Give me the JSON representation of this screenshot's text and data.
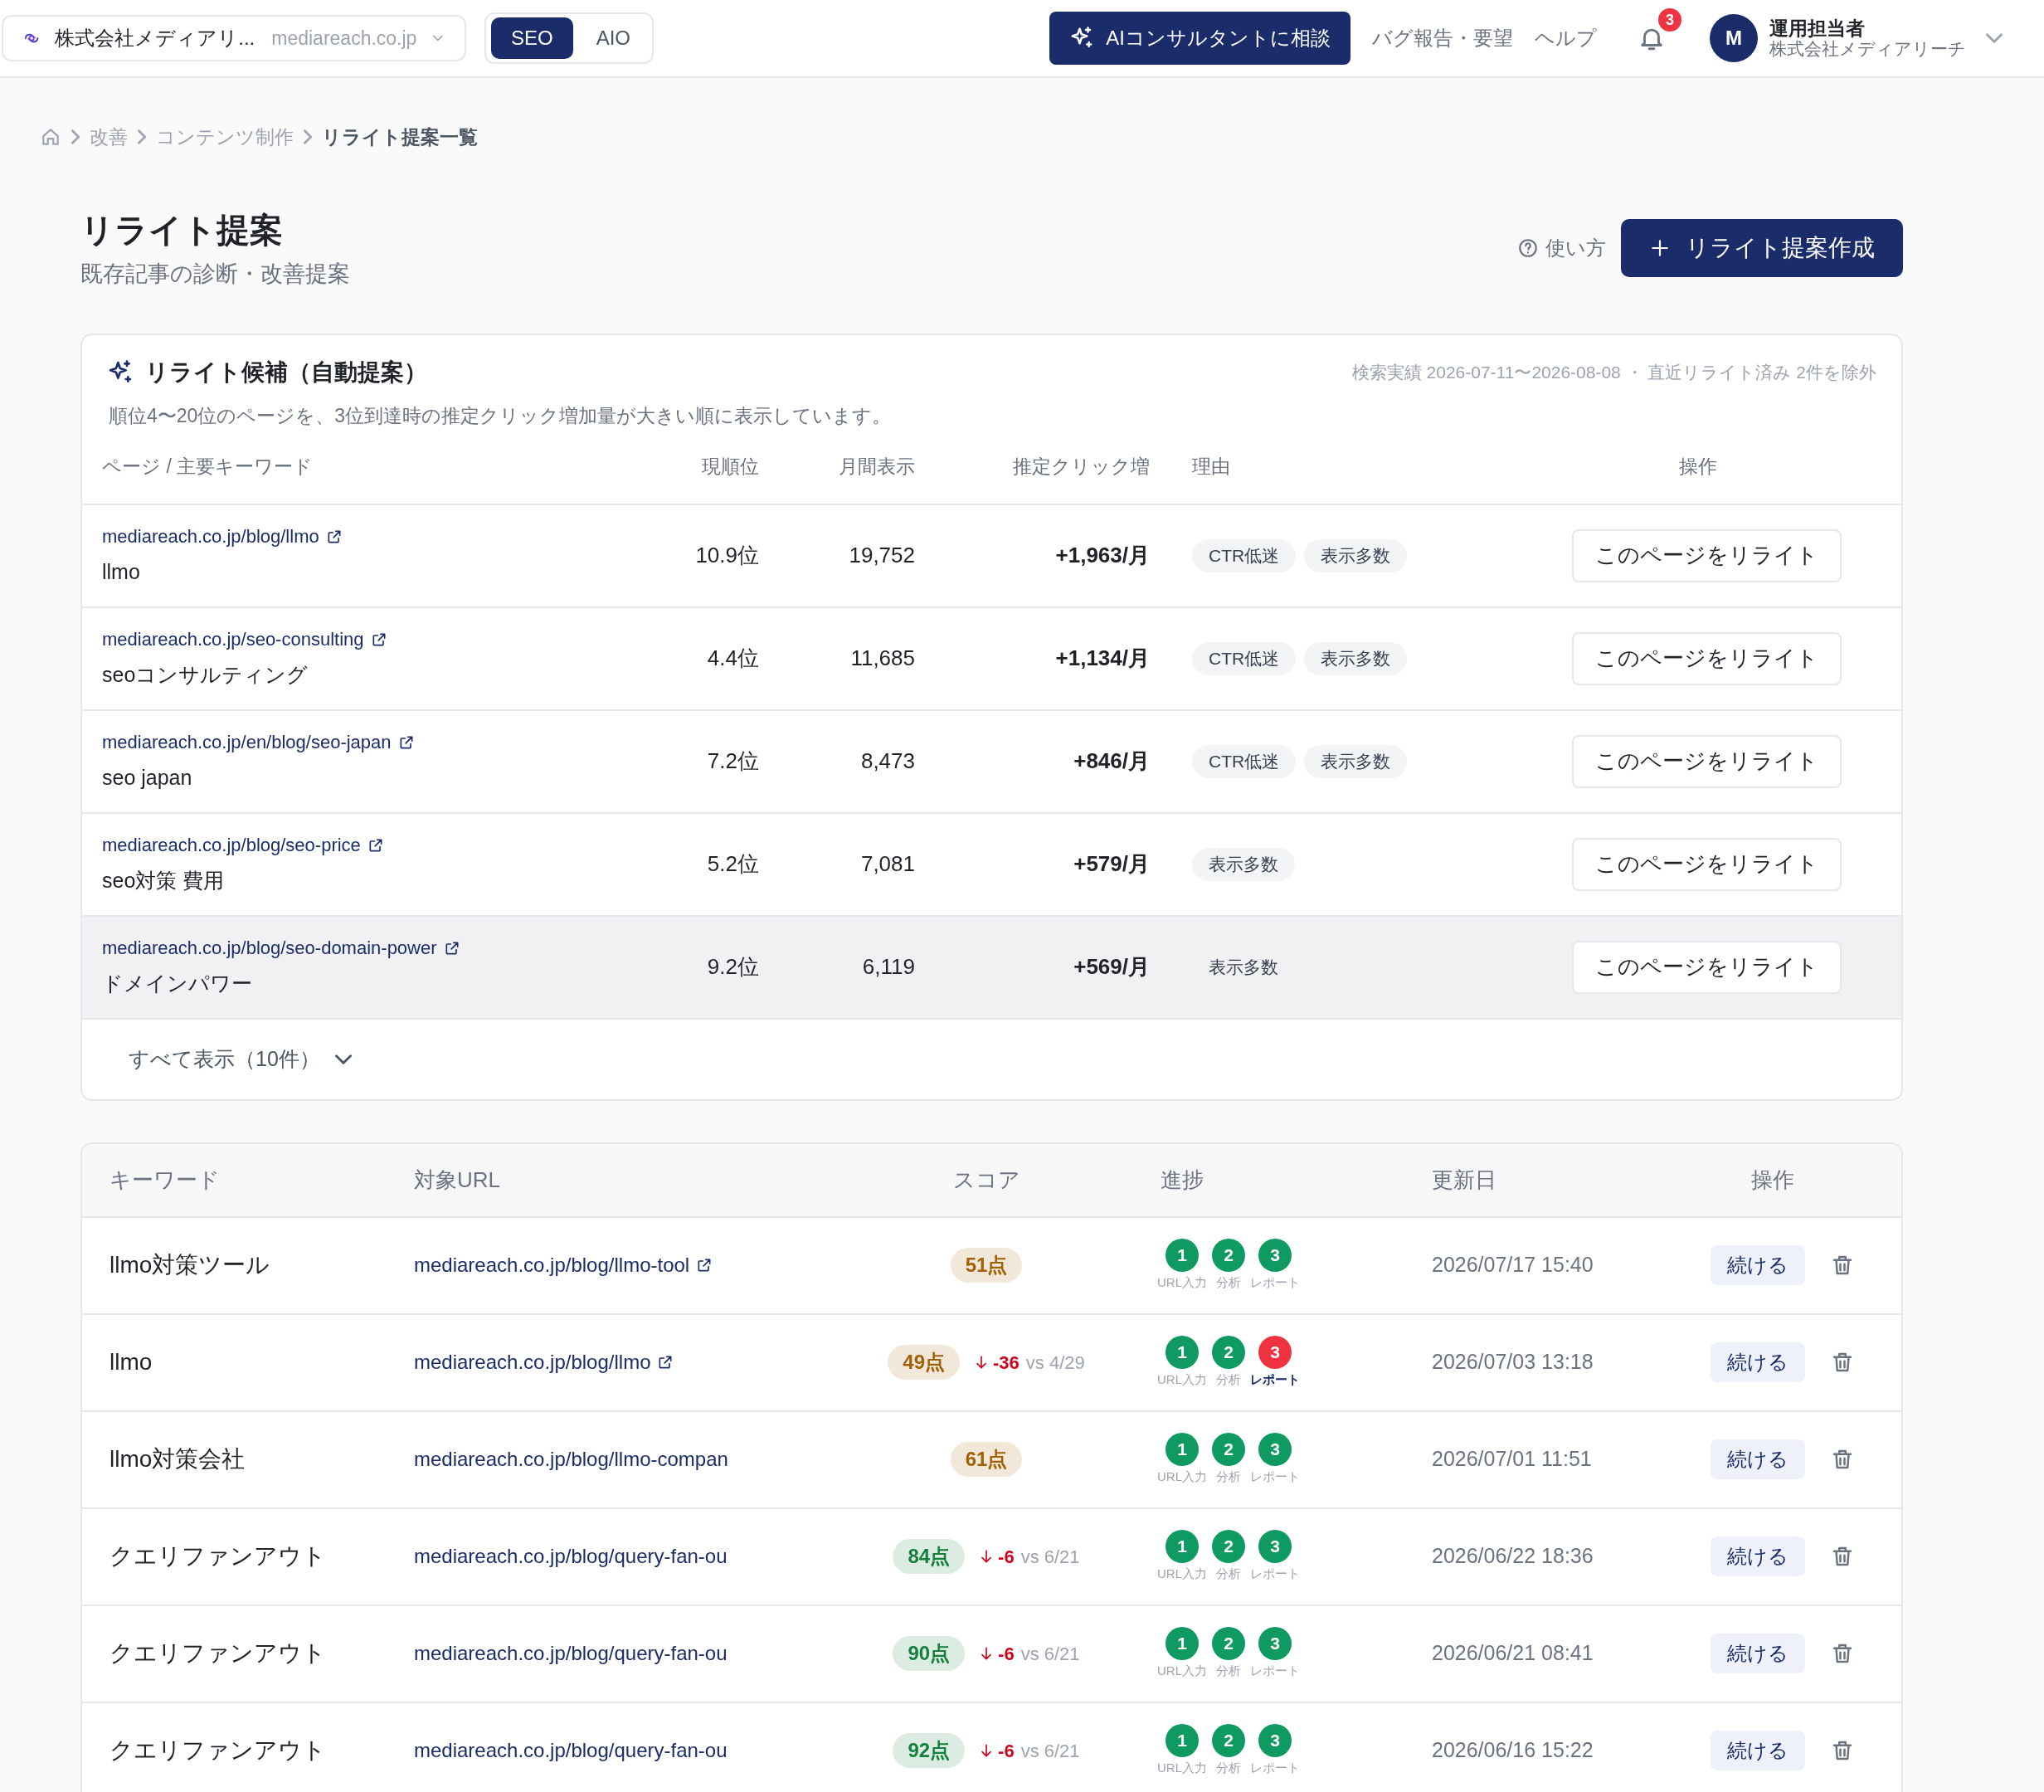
{
  "top_bar": {
    "org_selector": {
      "name": "株式会社メディアリ...",
      "domain": "mediareach.co.jp"
    },
    "mode_tabs": [
      {
        "label": "SEO",
        "selected": true
      },
      {
        "label": "AIO",
        "selected": false
      }
    ],
    "ai_button": "AIコンサルタントに相談",
    "links": [
      "バグ報告・要望",
      "ヘルプ"
    ],
    "notifications": "3",
    "user": {
      "initial": "M",
      "name": "運用担当者",
      "org": "株式会社メディアリーチ"
    }
  },
  "breadcrumb": [
    {
      "label": "改善",
      "current": false
    },
    {
      "label": "コンテンツ制作",
      "current": false
    },
    {
      "label": "リライト提案一覧",
      "current": true
    }
  ],
  "page": {
    "title": "リライト提案",
    "subtitle": "既存記事の診断・改善提案",
    "help_link": "使い方",
    "create_button": "リライト提案作成"
  },
  "candidates": {
    "title": "リライト候補（自動提案）",
    "meta": "検索実績 2026-07-11〜2026-08-08 ・ 直近リライト済み 2件を除外",
    "description": "順位4〜20位のページを、3位到達時の推定クリック増加量が大きい順に表示しています。",
    "columns": [
      "ページ / 主要キーワード",
      "現順位",
      "月間表示",
      "推定クリック増",
      "理由",
      "操作"
    ],
    "rows": [
      {
        "url": "mediareach.co.jp/blog/llmo",
        "keyword": "llmo",
        "rank": "10.9位",
        "impressions": "19,752",
        "click_gain": "+1,963/月",
        "reasons": [
          "CTR低迷",
          "表示多数"
        ],
        "action": "このページをリライト",
        "hovered": false
      },
      {
        "url": "mediareach.co.jp/seo-consulting",
        "keyword": "seoコンサルティング",
        "rank": "4.4位",
        "impressions": "11,685",
        "click_gain": "+1,134/月",
        "reasons": [
          "CTR低迷",
          "表示多数"
        ],
        "action": "このページをリライト",
        "hovered": false
      },
      {
        "url": "mediareach.co.jp/en/blog/seo-japan",
        "keyword": "seo japan",
        "rank": "7.2位",
        "impressions": "8,473",
        "click_gain": "+846/月",
        "reasons": [
          "CTR低迷",
          "表示多数"
        ],
        "action": "このページをリライト",
        "hovered": false
      },
      {
        "url": "mediareach.co.jp/blog/seo-price",
        "keyword": "seo対策 費用",
        "rank": "5.2位",
        "impressions": "7,081",
        "click_gain": "+579/月",
        "reasons": [
          "表示多数"
        ],
        "action": "このページをリライト",
        "hovered": false
      },
      {
        "url": "mediareach.co.jp/blog/seo-domain-power",
        "keyword": "ドメインパワー",
        "rank": "9.2位",
        "impressions": "6,119",
        "click_gain": "+569/月",
        "reasons": [
          "表示多数"
        ],
        "action": "このページをリライト",
        "hovered": true
      }
    ],
    "show_all": "すべて表示（10件）"
  },
  "history": {
    "columns": [
      "キーワード",
      "対象URL",
      "スコア",
      "進捗",
      "更新日",
      "操作"
    ],
    "rows": [
      {
        "keyword": "llmo対策ツール",
        "url": "mediareach.co.jp/blog/llmo-tool",
        "external": true,
        "score": "51点",
        "color": "#a16207",
        "delta": null,
        "steps": [
          {
            "number": "1",
            "label": "URL入力",
            "failed": false
          },
          {
            "number": "2",
            "label": "分析",
            "failed": false
          },
          {
            "number": "3",
            "label": "レポート",
            "failed": false
          }
        ],
        "updated": "2026/07/17 15:40",
        "action": "続ける"
      },
      {
        "keyword": "llmo",
        "url": "mediareach.co.jp/blog/llmo",
        "external": true,
        "score": "49点",
        "color": "#a16207",
        "delta": {
          "value": "-36",
          "vs": "vs 4/29"
        },
        "steps": [
          {
            "number": "1",
            "label": "URL入力",
            "failed": false
          },
          {
            "number": "2",
            "label": "分析",
            "failed": false
          },
          {
            "number": "3",
            "label": "レポート",
            "failed": true
          }
        ],
        "updated": "2026/07/03 13:18",
        "action": "続ける"
      },
      {
        "keyword": "llmo対策会社",
        "url": "mediareach.co.jp/blog/llmo-compan",
        "external": false,
        "score": "61点",
        "color": "#a16207",
        "delta": null,
        "steps": [
          {
            "number": "1",
            "label": "URL入力",
            "failed": false
          },
          {
            "number": "2",
            "label": "分析",
            "failed": false
          },
          {
            "number": "3",
            "label": "レポート",
            "failed": false
          }
        ],
        "updated": "2026/07/01 11:51",
        "action": "続ける"
      },
      {
        "keyword": "クエリファンアウト",
        "url": "mediareach.co.jp/blog/query-fan-ou",
        "external": false,
        "score": "84点",
        "color": "#15803d",
        "delta": {
          "value": "-6",
          "vs": "vs 6/21"
        },
        "steps": [
          {
            "number": "1",
            "label": "URL入力",
            "failed": false
          },
          {
            "number": "2",
            "label": "分析",
            "failed": false
          },
          {
            "number": "3",
            "label": "レポート",
            "failed": false
          }
        ],
        "updated": "2026/06/22 18:36",
        "action": "続ける"
      },
      {
        "keyword": "クエリファンアウト",
        "url": "mediareach.co.jp/blog/query-fan-ou",
        "external": false,
        "score": "90点",
        "color": "#15803d",
        "delta": {
          "value": "-6",
          "vs": "vs 6/21"
        },
        "steps": [
          {
            "number": "1",
            "label": "URL入力",
            "failed": false
          },
          {
            "number": "2",
            "label": "分析",
            "failed": false
          },
          {
            "number": "3",
            "label": "レポート",
            "failed": false
          }
        ],
        "updated": "2026/06/21 08:41",
        "action": "続ける"
      },
      {
        "keyword": "クエリファンアウト",
        "url": "mediareach.co.jp/blog/query-fan-ou",
        "external": false,
        "score": "92点",
        "color": "#15803d",
        "delta": {
          "value": "-6",
          "vs": "vs 6/21"
        },
        "steps": [
          {
            "number": "1",
            "label": "URL入力",
            "failed": false
          },
          {
            "number": "2",
            "label": "分析",
            "failed": false
          },
          {
            "number": "3",
            "label": "レポート",
            "failed": false
          }
        ],
        "updated": "2026/06/16 15:22",
        "action": "続ける"
      }
    ]
  }
}
